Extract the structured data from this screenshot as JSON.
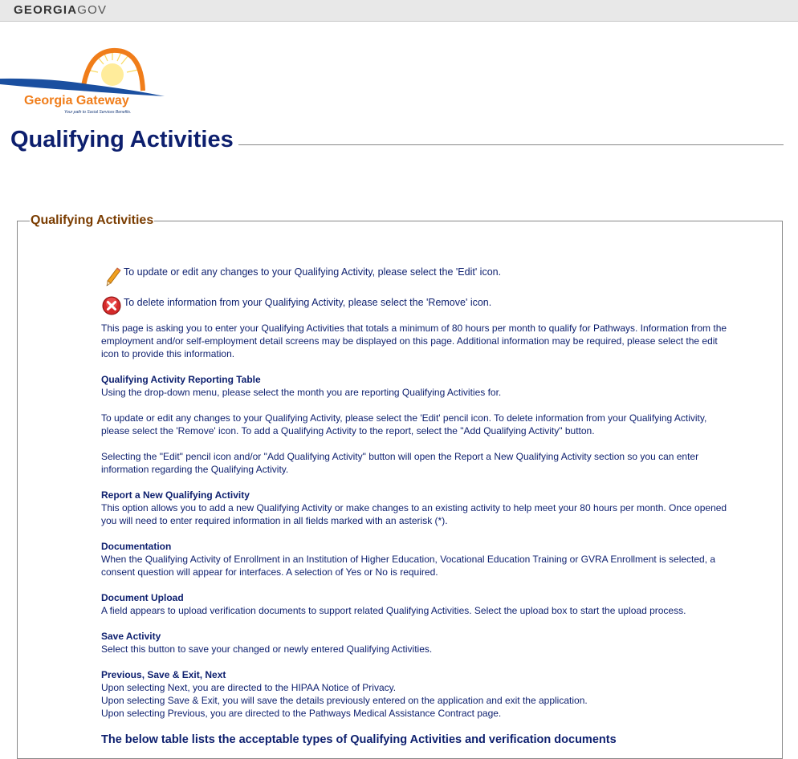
{
  "header": {
    "brand_bold": "GEORGIA",
    "brand_light": "GOV"
  },
  "logo": {
    "name": "Georgia Gateway",
    "tagline": "Your path to Social Services Benefits."
  },
  "page_title": "Qualifying Activities",
  "section": {
    "legend": "Qualifying Activities",
    "edit_hint": "To update or edit any changes to your Qualifying Activity, please select the 'Edit' icon.",
    "remove_hint": "To delete information from your Qualifying Activity, please select the 'Remove' icon.",
    "intro": "This page is asking you to enter your Qualifying Activities that totals a minimum of 80 hours per month to qualify for Pathways. Information from the employment and/or self-employment detail screens may be displayed on this page. Additional information may be required, please select the edit icon to provide this information.",
    "reporting_table": {
      "heading": "Qualifying Activity Reporting Table",
      "text": "Using the drop-down menu, please select the month you are reporting Qualifying Activities for."
    },
    "edit_remove_text": "To update or edit any changes to your Qualifying Activity, please select the 'Edit' pencil icon. To delete information from your Qualifying Activity, please select the 'Remove' icon. To add a Qualifying Activity to the report, select the \"Add Qualifying Activity\" button.",
    "selecting_text": "Selecting the \"Edit\" pencil icon and/or \"Add Qualifying Activity\" button will open the Report a New Qualifying Activity section so you can enter information regarding the Qualifying Activity.",
    "report_new": {
      "heading": "Report a New Qualifying Activity",
      "text": "This option allows you to add a new Qualifying Activity or make changes to an existing activity to help meet your 80 hours per month. Once opened you will need to enter required information in all fields marked with an asterisk (*)."
    },
    "documentation": {
      "heading": "Documentation",
      "text": "When the Qualifying Activity of Enrollment in an Institution of Higher Education, Vocational Education Training or GVRA Enrollment is selected, a consent question will appear for interfaces. A selection of Yes or No is required."
    },
    "document_upload": {
      "heading": "Document Upload",
      "text": "A field appears to upload verification documents to support related Qualifying Activities. Select the upload box to start the upload process."
    },
    "save_activity": {
      "heading": "Save Activity",
      "text": "Select this button to save your changed or newly entered Qualifying Activities."
    },
    "navigation": {
      "heading": "Previous, Save & Exit, Next",
      "line1": "Upon selecting Next, you are directed to the HIPAA Notice of Privacy.",
      "line2": "Upon selecting Save & Exit, you will save the details previously entered on the application and exit the application.",
      "line3": "Upon selecting Previous, you are directed to the Pathways Medical Assistance Contract page."
    },
    "table_heading": "The below table lists the acceptable types of Qualifying Activities and verification documents"
  }
}
